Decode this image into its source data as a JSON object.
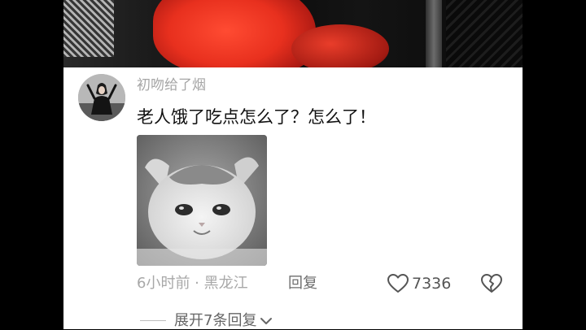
{
  "video": {
    "description_icon": "video-frame"
  },
  "comment": {
    "username": "初吻给了烟",
    "text": "老人饿了吃点怎么了？怎么了！",
    "sticker_icon": "crying-kitten-sticker",
    "time_location": "6小时前 · 黑龙江",
    "reply_label": "回复",
    "like_icon": "heart-outline-icon",
    "like_count": "7336",
    "dislike_icon": "broken-heart-icon"
  },
  "replies": {
    "expand_label": "展开7条回复",
    "expand_icon": "chevron-down-icon"
  },
  "colors": {
    "username": "#a6a6a6",
    "text": "#111111",
    "meta": "#a8a8a8",
    "panel_bg": "#ffffff"
  }
}
